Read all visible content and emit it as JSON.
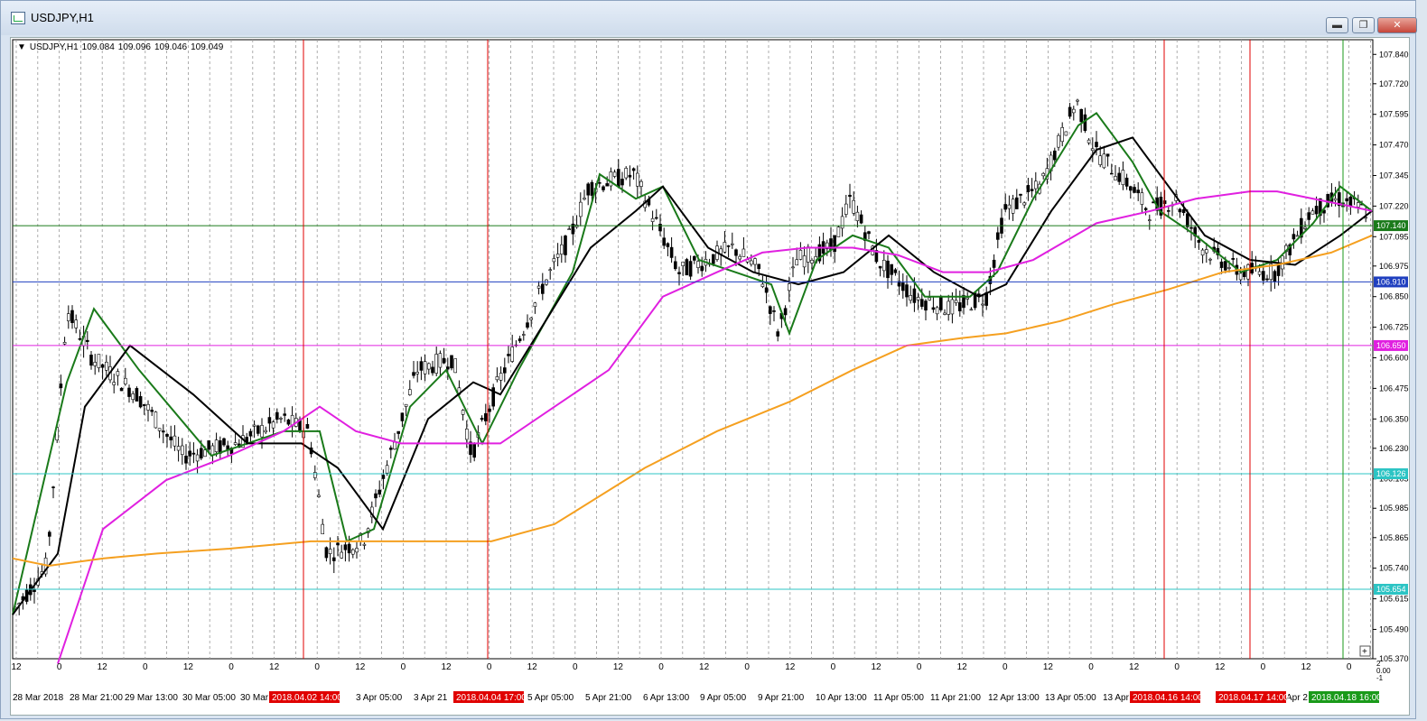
{
  "window": {
    "title": "USDJPY,H1",
    "buttons": {
      "minimize": "▬",
      "maximize": "❐",
      "close": "✕"
    }
  },
  "chart_header": {
    "symbol": "USDJPY,H1",
    "ohlc": [
      "109.084",
      "109.096",
      "109.046",
      "109.049"
    ]
  },
  "chart_data": {
    "type": "candlestick",
    "ylim": [
      10.5,
      10.8
    ],
    "price_axis_labels": [
      "107.840",
      "107.720",
      "107.595",
      "107.470",
      "107.345",
      "107.220",
      "107.095",
      "106.975",
      "106.850",
      "106.725",
      "106.600",
      "106.475",
      "106.350",
      "106.230",
      "106.105",
      "105.985",
      "105.865",
      "105.740",
      "105.615",
      "105.490",
      "105.370"
    ],
    "price_range": [
      105.37,
      107.9
    ],
    "hour_tick_labels": [
      "12",
      "0",
      "12",
      "0",
      "12",
      "0",
      "12",
      "0",
      "12",
      "0",
      "12",
      "0",
      "12",
      "0",
      "12",
      "0",
      "12",
      "0",
      "12",
      "0",
      "12",
      "0",
      "12",
      "0",
      "12",
      "0",
      "12",
      "0",
      "12",
      "0",
      "12",
      "0"
    ],
    "date_labels": [
      "28 Mar 2018",
      "28 Mar 21:00",
      "29 Mar 13:00",
      "30 Mar 05:00",
      "30 Mar",
      "3 Apr 05:00",
      "3 Apr 21",
      "5 Apr 05:00",
      "5 Apr 21:00",
      "6 Apr 13:00",
      "9 Apr 05:00",
      "9 Apr 21:00",
      "10 Apr 13:00",
      "11 Apr 05:00",
      "11 Apr 21:00",
      "12 Apr 13:00",
      "13 Apr 05:00",
      "13 Apr",
      "Apr 2"
    ],
    "horizontal_levels": [
      {
        "price": 107.14,
        "label": "107.140",
        "color": "#1a7a1a"
      },
      {
        "price": 106.91,
        "label": "106.910",
        "color": "#1f3fbf"
      },
      {
        "price": 106.65,
        "label": "106.650",
        "color": "#e020e0"
      },
      {
        "price": 106.126,
        "label": "106.126",
        "color": "#2cc4c4"
      },
      {
        "price": 105.654,
        "label": "105.654",
        "color": "#2cc4c4"
      }
    ],
    "vertical_markers": [
      {
        "label": "2018.04.02 14:00",
        "color": "#e00000"
      },
      {
        "label": "2018.04.04 17:00",
        "color": "#e00000"
      },
      {
        "label": "2018.04.16 14:00",
        "color": "#e00000"
      },
      {
        "label": "2018.04.17 14:00",
        "color": "#e00000"
      },
      {
        "label": "2018.04.18 16:00",
        "color": "#1a9a1a"
      }
    ],
    "moving_averages": [
      {
        "color": "#1a7a1a"
      },
      {
        "color": "#000000"
      },
      {
        "color": "#e020e0"
      },
      {
        "color": "#f5a020"
      }
    ],
    "indicator_axis": [
      "2",
      "0.00",
      "-1"
    ]
  }
}
